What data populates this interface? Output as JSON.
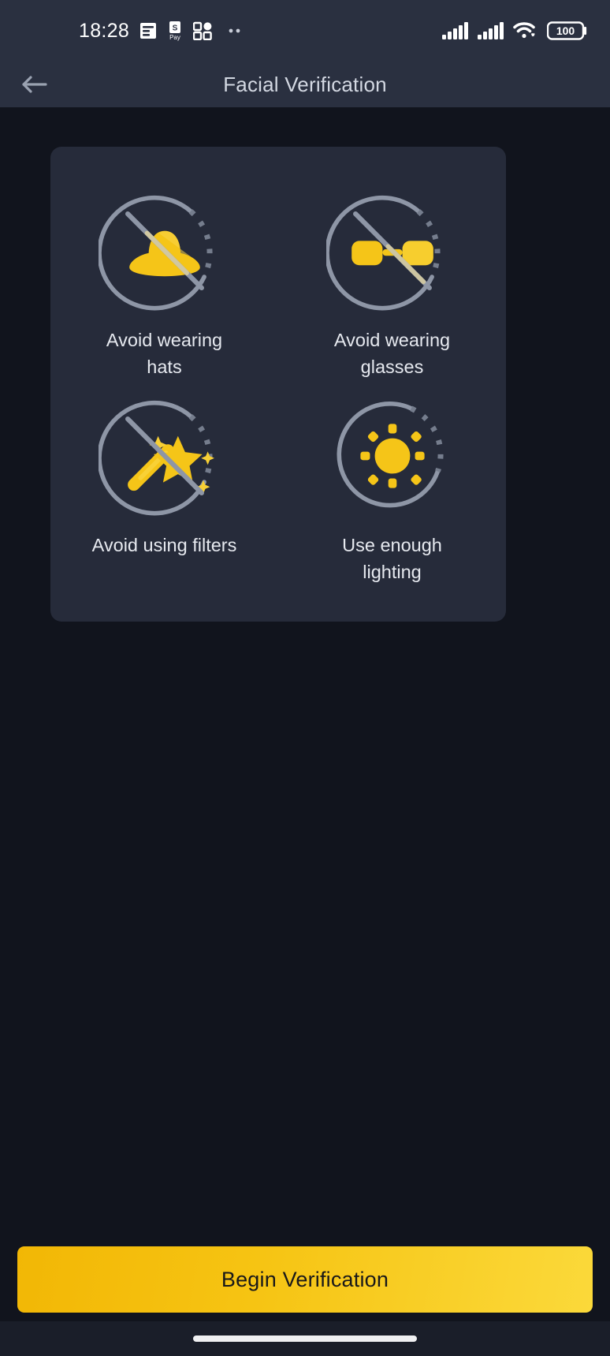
{
  "status_bar": {
    "time": "18:28",
    "battery_level": "100",
    "left_icons": [
      "news-feed-icon",
      "spay-icon",
      "app-grid-icon",
      "more-dots-icon"
    ],
    "right_icons": [
      "signal-bars-sim1-icon",
      "signal-bars-sim2-icon",
      "wifi-icon",
      "battery-icon"
    ],
    "colors": {
      "background": "#2a3040",
      "foreground": "#ffffff"
    }
  },
  "header": {
    "title": "Facial Verification",
    "back_icon": "arrow-left-icon",
    "colors": {
      "background": "#2a3040",
      "title": "#d3d8e2"
    }
  },
  "tips": {
    "items": [
      {
        "icon": "no-hat-icon",
        "label": "Avoid wearing hats"
      },
      {
        "icon": "no-glasses-icon",
        "label": "Avoid wearing glasses"
      },
      {
        "icon": "no-filters-icon",
        "label": "Avoid using filters"
      },
      {
        "icon": "bright-sun-icon",
        "label": "Use enough lighting"
      }
    ],
    "colors": {
      "card_background": "#262b3a",
      "label": "#e6e9ef",
      "icon_accent": "#f5c518",
      "icon_accent_dark": "#f2b705",
      "icon_outline": "#8e96a6"
    }
  },
  "footer": {
    "primary_button_label": "Begin Verification",
    "colors": {
      "button_gradient_start": "#f2b705",
      "button_gradient_end": "#fbd93a",
      "button_text": "#18181a"
    }
  },
  "page": {
    "background": "#11141d"
  }
}
